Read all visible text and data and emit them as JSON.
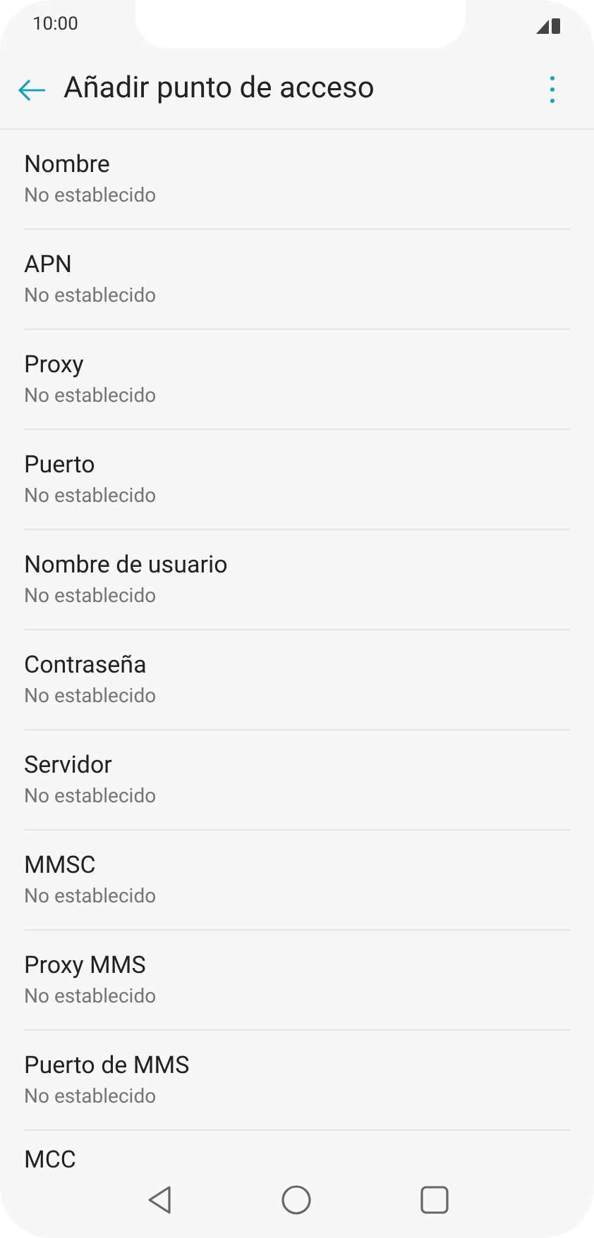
{
  "status_bar": {
    "time": "10:00"
  },
  "app_bar": {
    "title": "Añadir punto de acceso"
  },
  "settings": [
    {
      "title": "Nombre",
      "summary": "No establecido"
    },
    {
      "title": "APN",
      "summary": "No establecido"
    },
    {
      "title": "Proxy",
      "summary": "No establecido"
    },
    {
      "title": "Puerto",
      "summary": "No establecido"
    },
    {
      "title": "Nombre de usuario",
      "summary": "No establecido"
    },
    {
      "title": "Contraseña",
      "summary": "No establecido"
    },
    {
      "title": "Servidor",
      "summary": "No establecido"
    },
    {
      "title": "MMSC",
      "summary": "No establecido"
    },
    {
      "title": "Proxy MMS",
      "summary": "No establecido"
    },
    {
      "title": "Puerto de MMS",
      "summary": "No establecido"
    },
    {
      "title": "MCC"
    }
  ]
}
